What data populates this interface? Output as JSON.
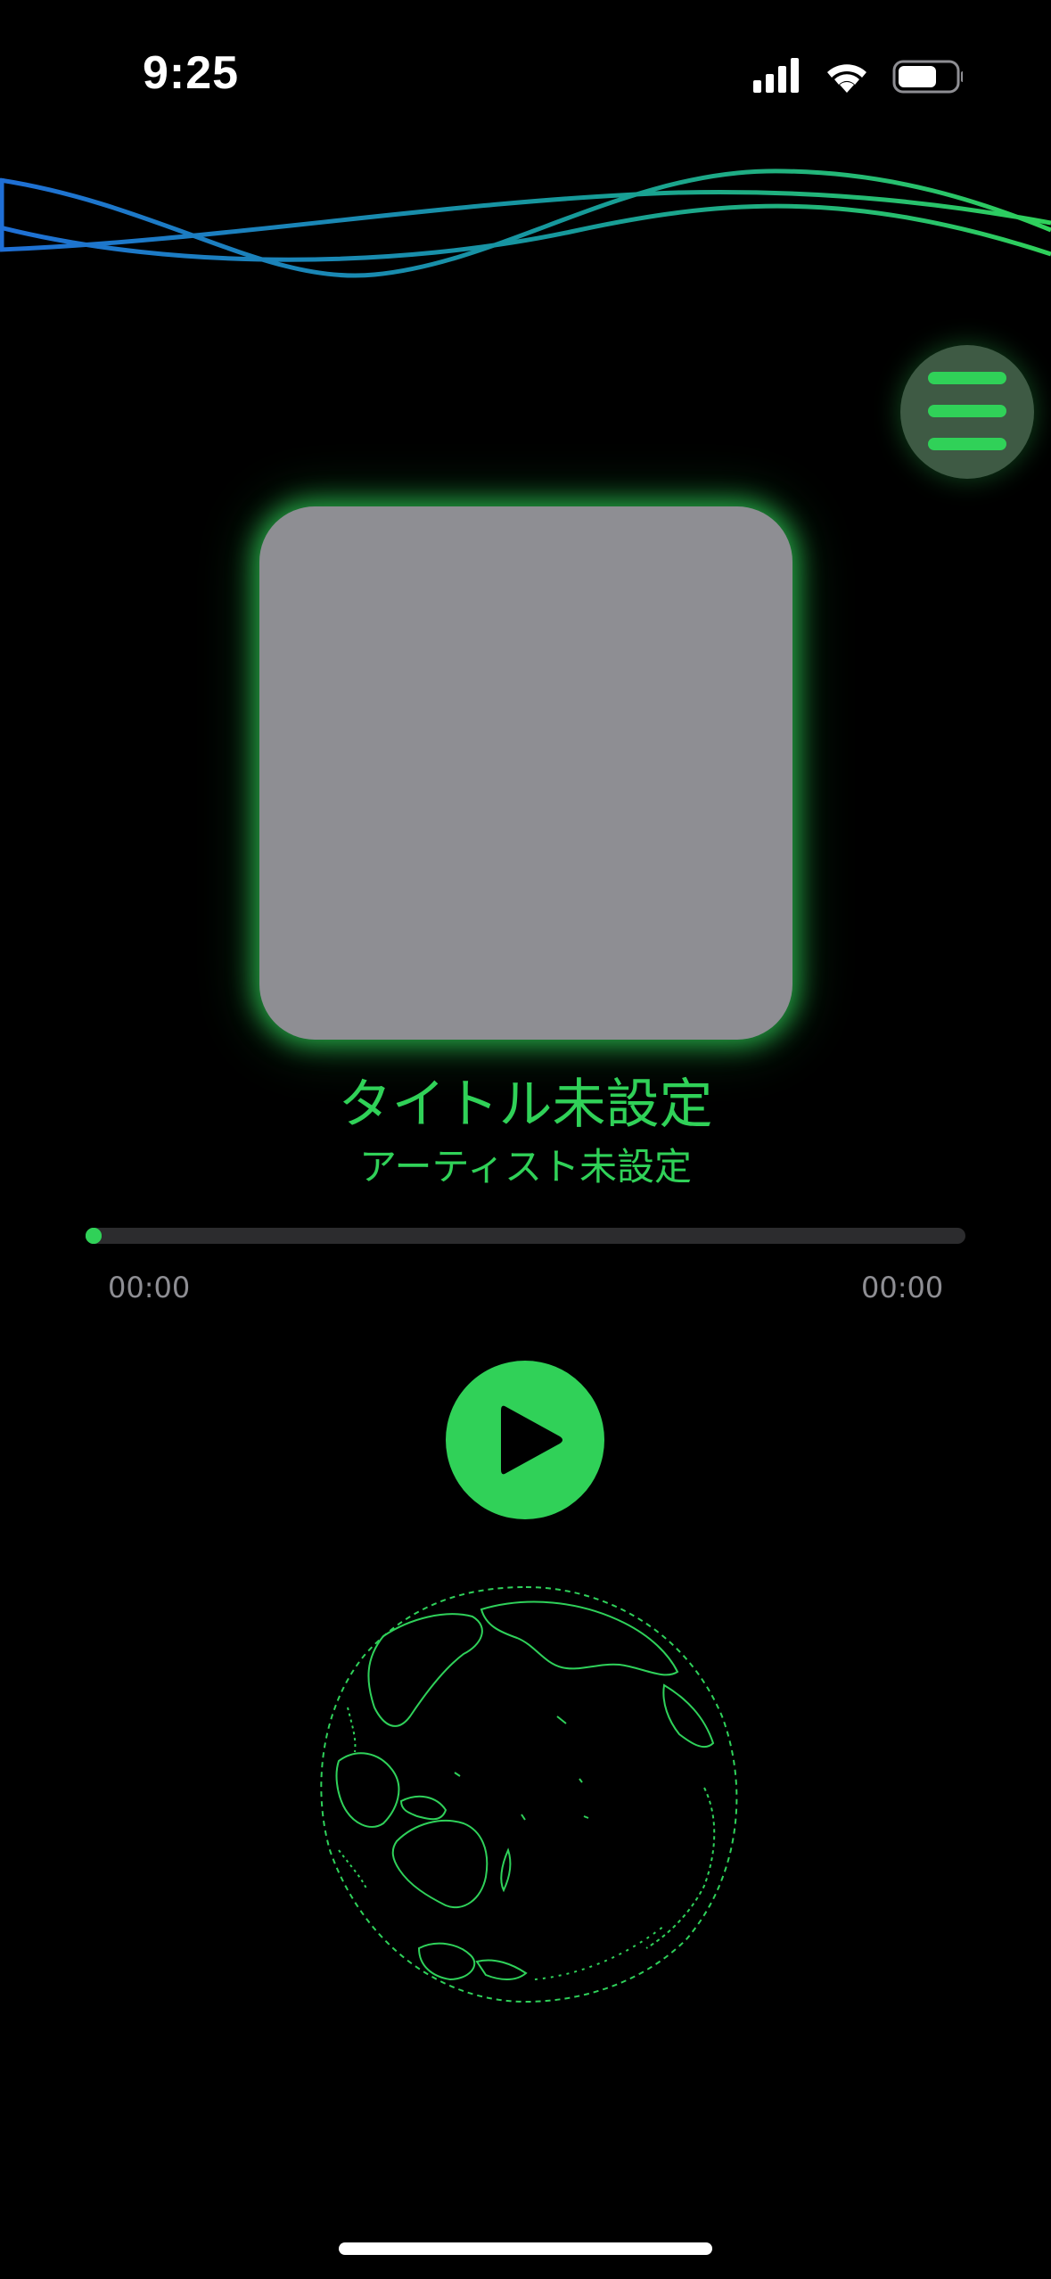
{
  "status_bar": {
    "time": "9:25",
    "icons": [
      "cellular-signal-icon",
      "wifi-icon",
      "battery-icon"
    ]
  },
  "menu": {
    "icon": "hamburger-menu-icon"
  },
  "now_playing": {
    "title": "タイトル未設定",
    "artist": "アーティスト未設定",
    "elapsed": "00:00",
    "duration": "00:00",
    "progress_fraction": 0
  },
  "controls": {
    "play_icon": "play-icon"
  },
  "visual": {
    "globe_icon": "wireframe-globe-icon"
  },
  "colors": {
    "accent": "#30d158",
    "background": "#000000",
    "artwork_placeholder": "#8e8e93",
    "secondary_text": "#8e8e93",
    "wave_blue": "#1f6fd6",
    "wave_green": "#2fd15a"
  }
}
